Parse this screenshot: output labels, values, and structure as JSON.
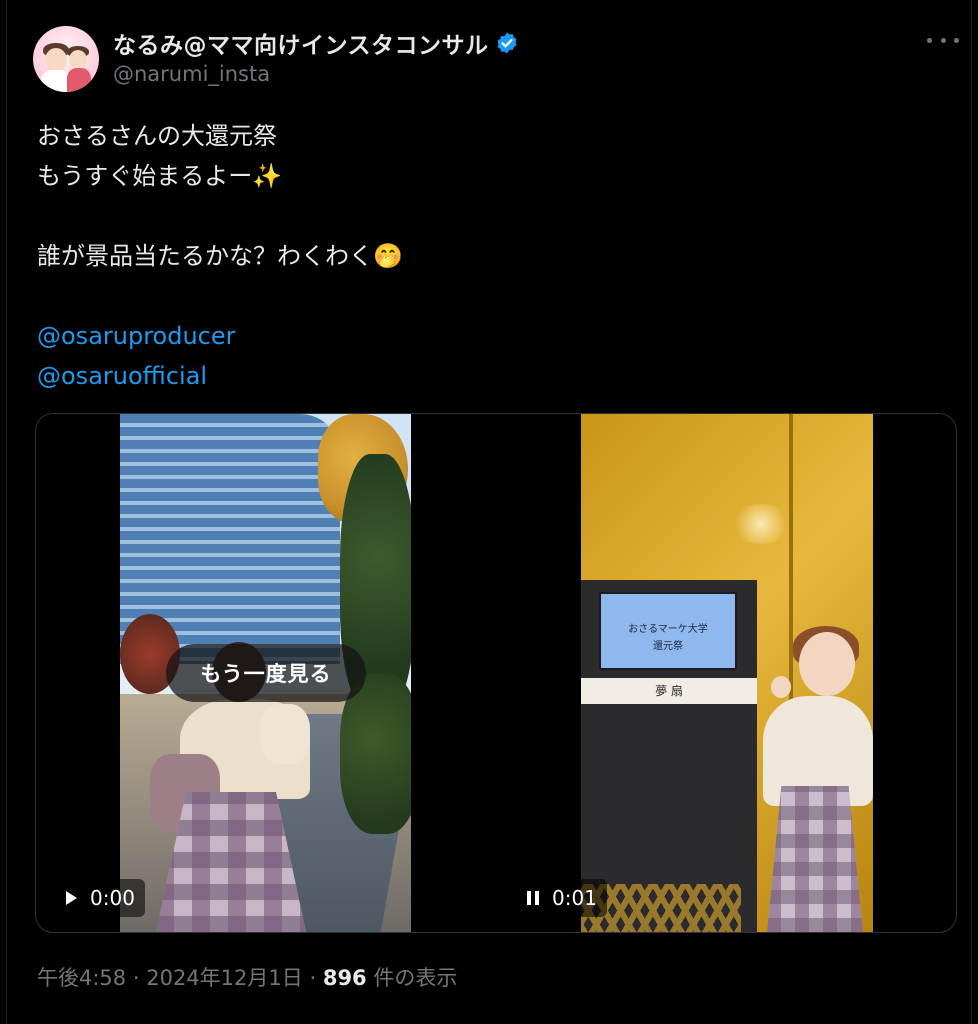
{
  "author": {
    "display_name": "なるみ@ママ向けインスタコンサル",
    "handle": "@narumi_insta",
    "verified_color": "#1d9bf0"
  },
  "more_icon": "more-horizontal-icon",
  "tweet": {
    "lines": [
      "おさるさんの大還元祭",
      "もうすぐ始まるよー✨",
      "",
      "誰が景品当たるかな？わくわく🤭",
      ""
    ],
    "mentions": [
      "@osaruproducer",
      "@osaruofficial"
    ]
  },
  "media": {
    "replay_label": "もう一度見る",
    "left_video": {
      "time": "0:00",
      "control_icon": "play-icon"
    },
    "right_video": {
      "time": "0:01",
      "control_icon": "pause-icon",
      "screen_line1": "おさるマーケ大学",
      "screen_line2": "還元祭",
      "plate_label": "夢 扇"
    }
  },
  "footer": {
    "time": "午後4:58",
    "sep1": "·",
    "date": "2024年12月1日",
    "sep2": "·",
    "views_count": "896",
    "views_label": "件の表示"
  },
  "colors": {
    "background": "#000000",
    "text": "#e7e9ea",
    "muted": "#71767b",
    "link": "#1d9bf0"
  }
}
